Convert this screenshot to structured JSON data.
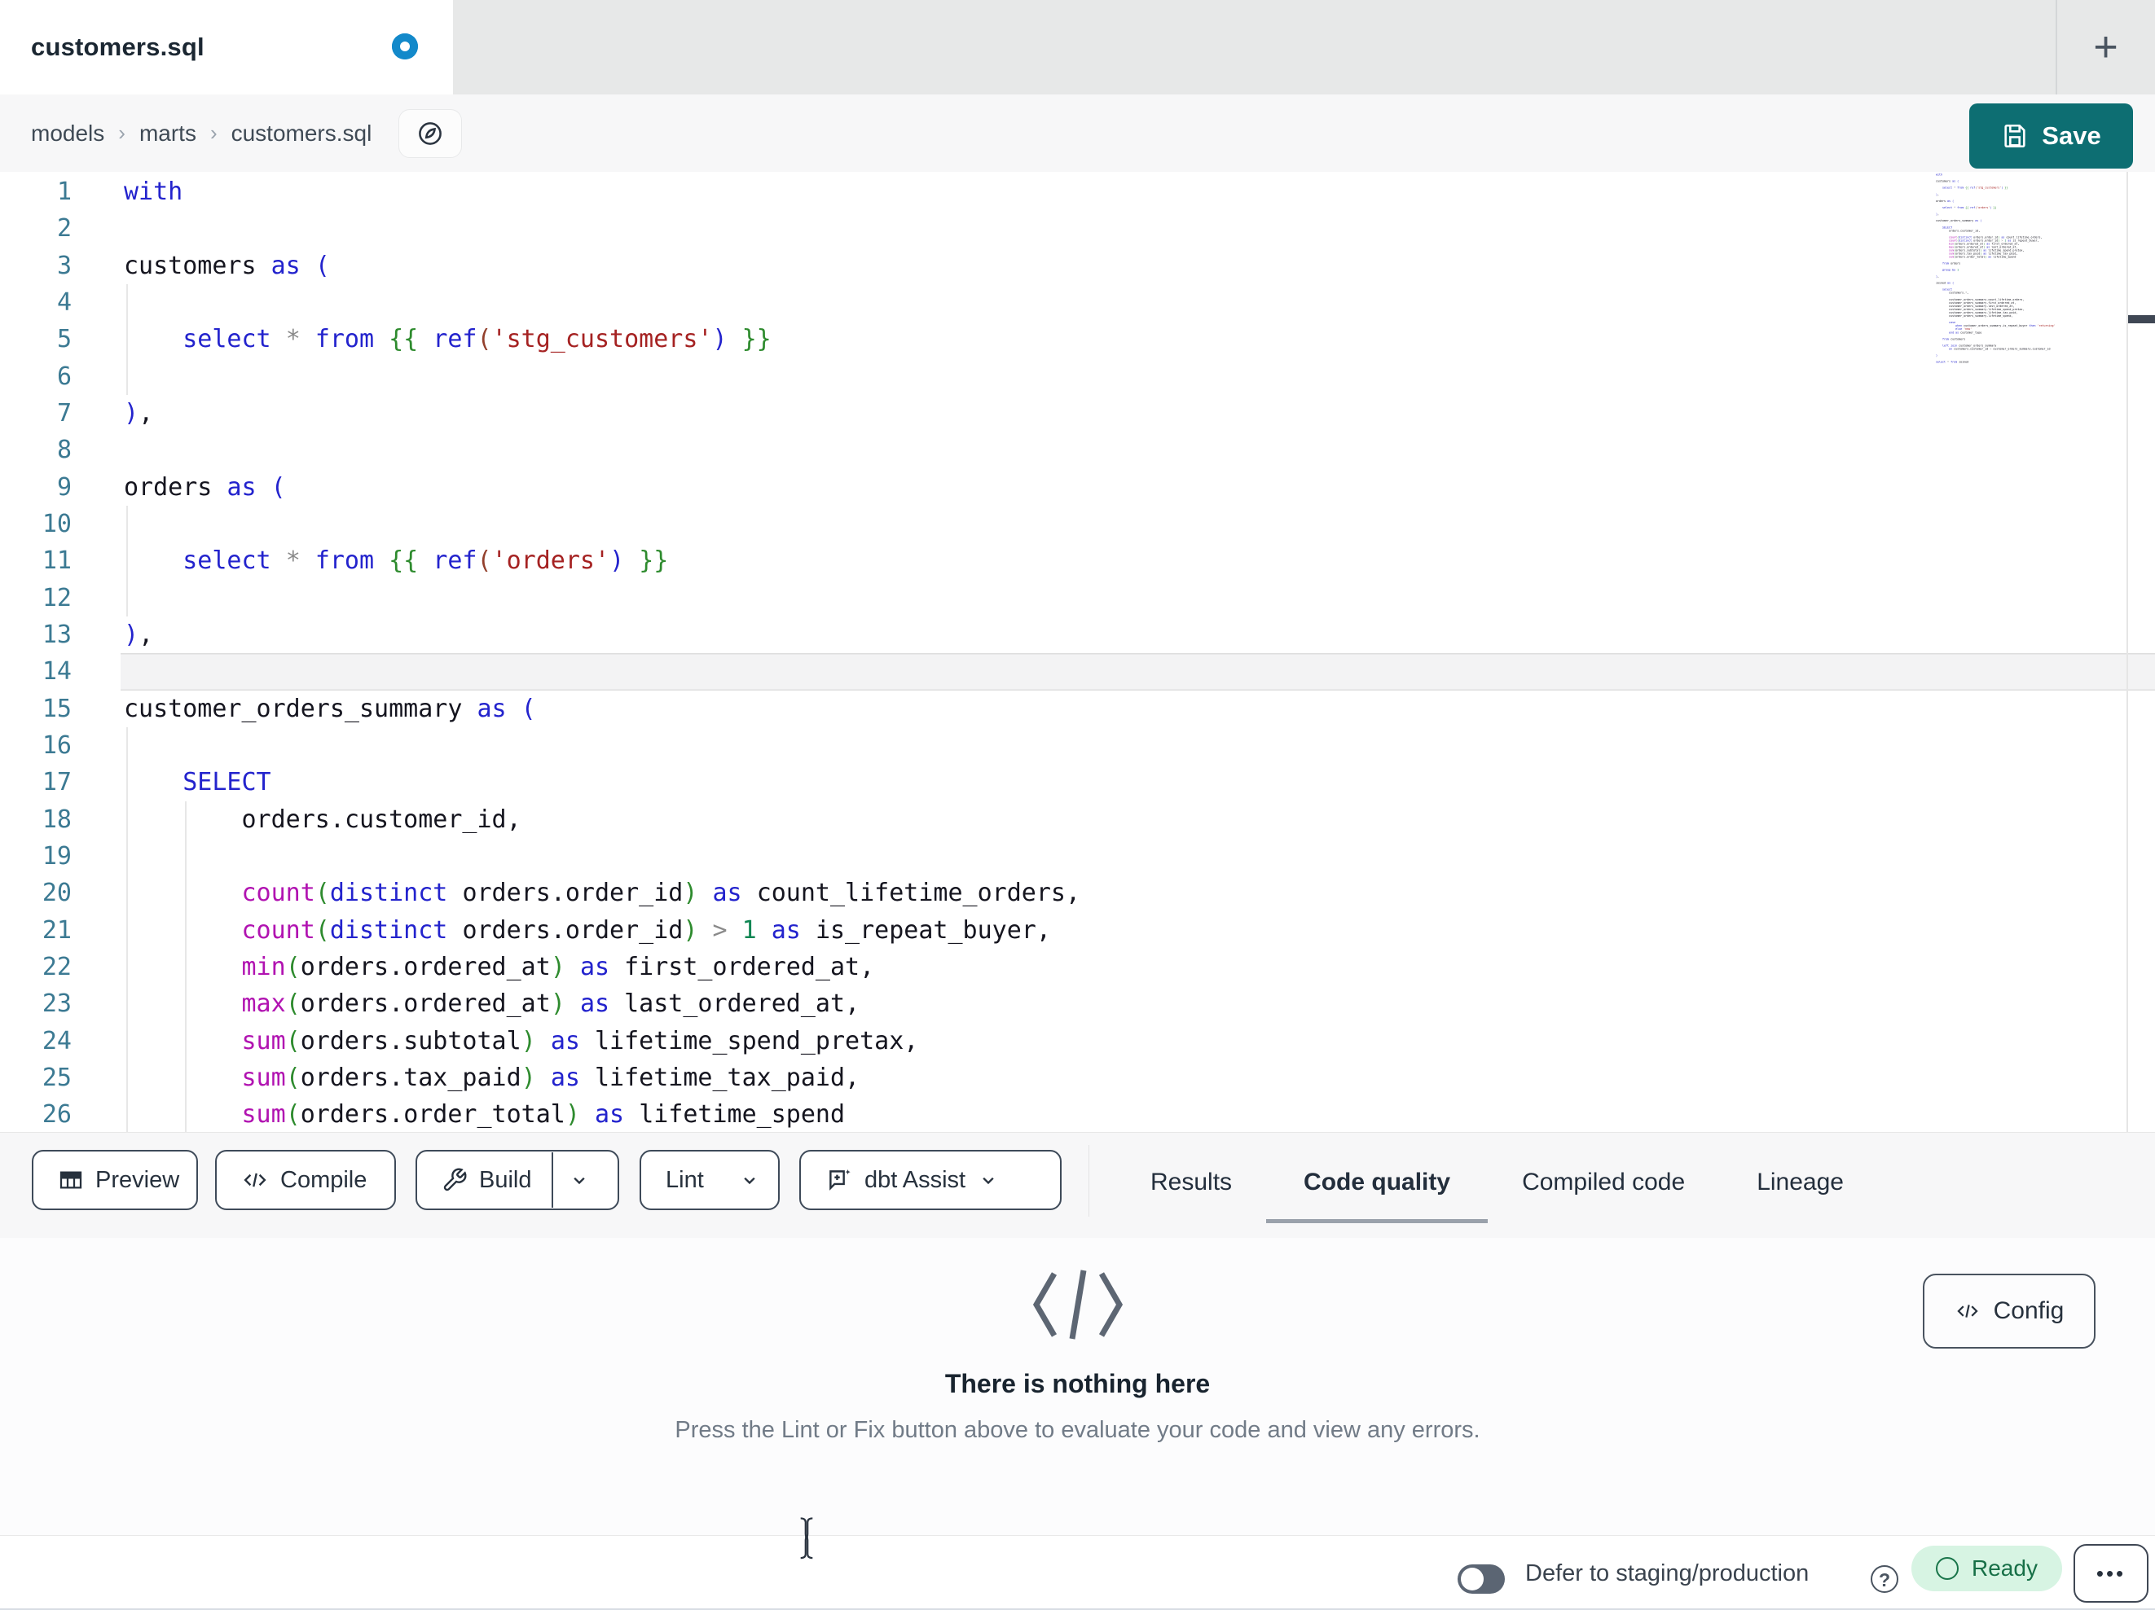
{
  "tab_bar": {
    "active_tab_label": "customers.sql",
    "unsaved_indicator": true,
    "new_tab_label": "+"
  },
  "breadcrumb": {
    "segments": [
      "models",
      "marts",
      "customers.sql"
    ],
    "separator": "›"
  },
  "actions": {
    "save_label": "Save"
  },
  "editor": {
    "language": "sql",
    "active_line": 14,
    "first_visible_line": 1,
    "visible_line_count": 26,
    "document_lines": [
      "with",
      "",
      "customers as (",
      "",
      "    select * from {{ ref('stg_customers') }}",
      "",
      "),",
      "",
      "orders as (",
      "",
      "    select * from {{ ref('orders') }}",
      "",
      "),",
      "",
      "customer_orders_summary as (",
      "",
      "    SELECT",
      "        orders.customer_id,",
      "",
      "        count(distinct orders.order_id) as count_lifetime_orders,",
      "        count(distinct orders.order_id) > 1 as is_repeat_buyer,",
      "        min(orders.ordered_at) as first_ordered_at,",
      "        max(orders.ordered_at) as last_ordered_at,",
      "        sum(orders.subtotal) as lifetime_spend_pretax,",
      "        sum(orders.tax_paid) as lifetime_tax_paid,",
      "        sum(orders.order_total) as lifetime_spend",
      "",
      "    from orders",
      "",
      "    group by 1",
      "",
      "),",
      "",
      "joined as (",
      "",
      "    select",
      "        customers.*,",
      "",
      "        customer_orders_summary.count_lifetime_orders,",
      "        customer_orders_summary.first_ordered_at,",
      "        customer_orders_summary.last_ordered_at,",
      "        customer_orders_summary.lifetime_spend_pretax,",
      "        customer_orders_summary.lifetime_tax_paid,",
      "        customer_orders_summary.lifetime_spend,",
      "",
      "        case",
      "            when customer_orders_summary.is_repeat_buyer then 'returning'",
      "            else 'new'",
      "        end as customer_type",
      "",
      "    from customers",
      "",
      "    left join customer_orders_summary",
      "        on customers.customer_id = customer_orders_summary.customer_id",
      "",
      ")",
      "",
      "select * from joined"
    ],
    "token_colors": {
      "keyword": "#2323cd",
      "function": "#b113b1",
      "string": "#a52222",
      "jinja_braces": "#2e8b2e",
      "function_paren": "#2e8b2e",
      "jinja_paren": "#93402c",
      "bracket": "#2323cd",
      "number": "#108653",
      "operator": "#8a8a8a",
      "default": "#15151f",
      "line_number": "#3c7a93"
    }
  },
  "toolbar": {
    "preview": {
      "label": "Preview",
      "icon": "table-icon"
    },
    "compile": {
      "label": "Compile",
      "icon": "code-icon"
    },
    "build": {
      "label": "Build",
      "icon": "wrench-icon",
      "has_dropdown": true
    },
    "lint": {
      "label": "Lint",
      "has_dropdown": true
    },
    "dbt_assist": {
      "label": "dbt Assist",
      "icon": "assist-icon",
      "has_dropdown": true
    }
  },
  "panel_tabs": {
    "items": [
      "Results",
      "Code quality",
      "Compiled code",
      "Lineage"
    ],
    "active": "Code quality"
  },
  "empty_state": {
    "icon": "code-slash-icon",
    "title": "There is nothing here",
    "subtitle": "Press the Lint or Fix button above to evaluate your code and view any errors."
  },
  "config": {
    "label": "Config",
    "icon": "code-icon"
  },
  "status_bar": {
    "defer_toggle": {
      "label": "Defer to staging/production",
      "state": "off"
    },
    "status_badge": {
      "label": "Ready",
      "text_color": "#176f47",
      "bg_color": "#d7f4e3"
    },
    "overflow_menu_icon": "•••"
  },
  "colors": {
    "accent_teal": "#0d6e72",
    "tab_bar_bg": "#e7e8e8",
    "bar_bg": "#f7f7f8",
    "unsaved_dot_blue": "#1389ca",
    "active_line_bg": "#f3f3f4",
    "button_border": "#3e4a59",
    "tab_underline": "#9aa1ab"
  }
}
